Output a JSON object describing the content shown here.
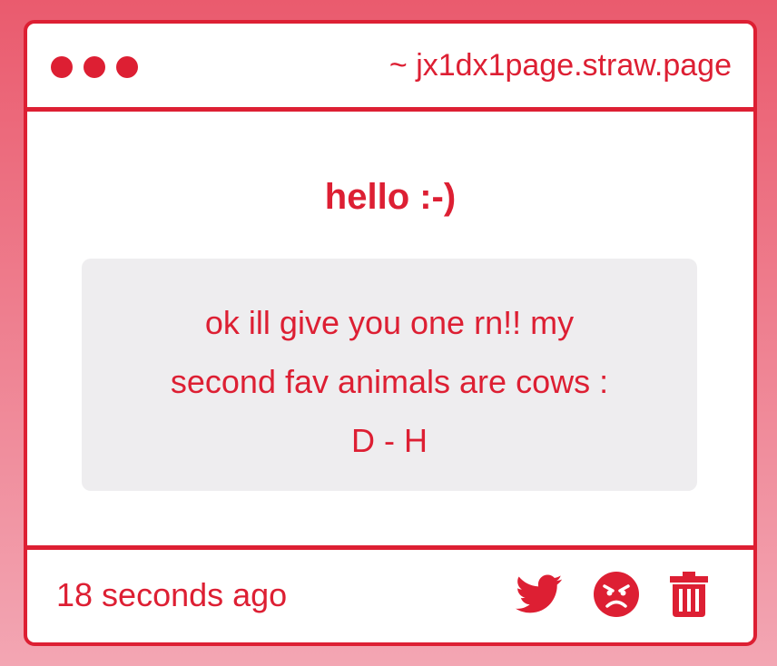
{
  "window": {
    "url": "~ jx1dx1page.straw.page"
  },
  "post": {
    "heading": "hello :-)",
    "message_line1": "ok ill give you one rn!! my",
    "message_line2": "second fav animals are cows :",
    "message_line3": "D - H"
  },
  "footer": {
    "timestamp": "18 seconds ago",
    "icons": [
      "twitter-icon",
      "angry-face-icon",
      "trash-icon"
    ]
  },
  "colors": {
    "accent": "#dd1f33",
    "background_top": "#ea5b6e",
    "background_bottom": "#f3a6b3",
    "card": "#ffffff",
    "message_box": "#eeedef"
  }
}
